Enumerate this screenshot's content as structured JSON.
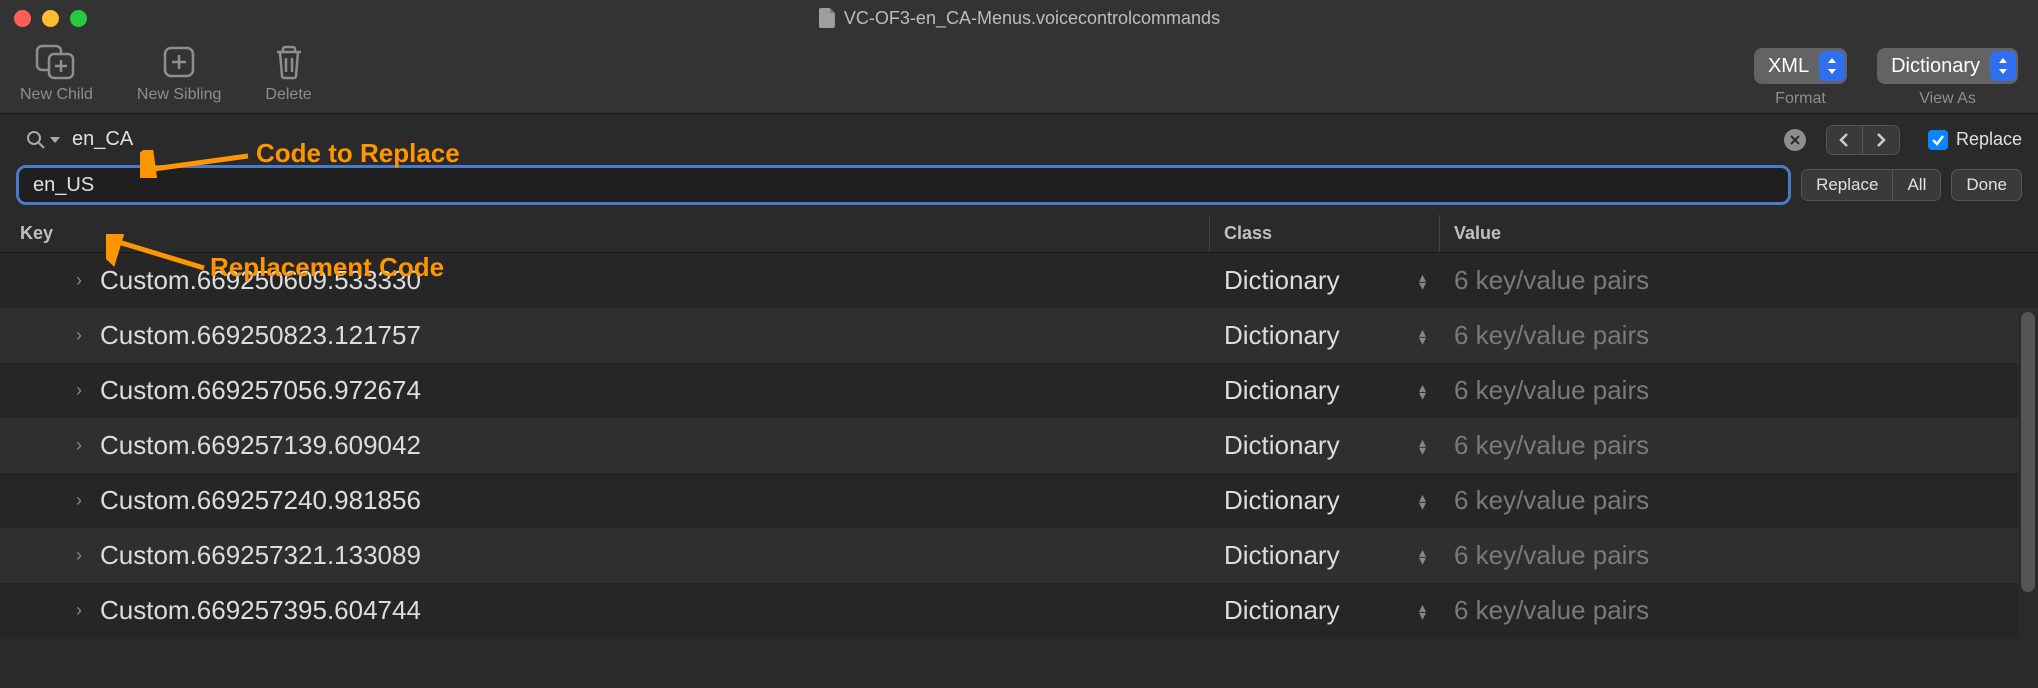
{
  "window": {
    "title": "VC-OF3-en_CA-Menus.voicecontrolcommands"
  },
  "toolbar": {
    "new_child": {
      "label": "New Child"
    },
    "new_sibling": {
      "label": "New Sibling"
    },
    "delete": {
      "label": "Delete"
    },
    "format": {
      "value": "XML",
      "label": "Format"
    },
    "view_as": {
      "value": "Dictionary",
      "label": "View As"
    }
  },
  "search": {
    "find_value": "en_CA",
    "replace_value": "en_US",
    "replace_checkbox_label": "Replace",
    "replace_button": "Replace",
    "all_button": "All",
    "done_button": "Done"
  },
  "annotations": {
    "code_to_replace": "Code to Replace",
    "replacement_code": "Replacement Code"
  },
  "table": {
    "headers": {
      "key": "Key",
      "class": "Class",
      "value": "Value"
    },
    "rows": [
      {
        "key": "Custom.669250609.533330",
        "class": "Dictionary",
        "value": "6 key/value pairs"
      },
      {
        "key": "Custom.669250823.121757",
        "class": "Dictionary",
        "value": "6 key/value pairs"
      },
      {
        "key": "Custom.669257056.972674",
        "class": "Dictionary",
        "value": "6 key/value pairs"
      },
      {
        "key": "Custom.669257139.609042",
        "class": "Dictionary",
        "value": "6 key/value pairs"
      },
      {
        "key": "Custom.669257240.981856",
        "class": "Dictionary",
        "value": "6 key/value pairs"
      },
      {
        "key": "Custom.669257321.133089",
        "class": "Dictionary",
        "value": "6 key/value pairs"
      },
      {
        "key": "Custom.669257395.604744",
        "class": "Dictionary",
        "value": "6 key/value pairs"
      }
    ]
  }
}
